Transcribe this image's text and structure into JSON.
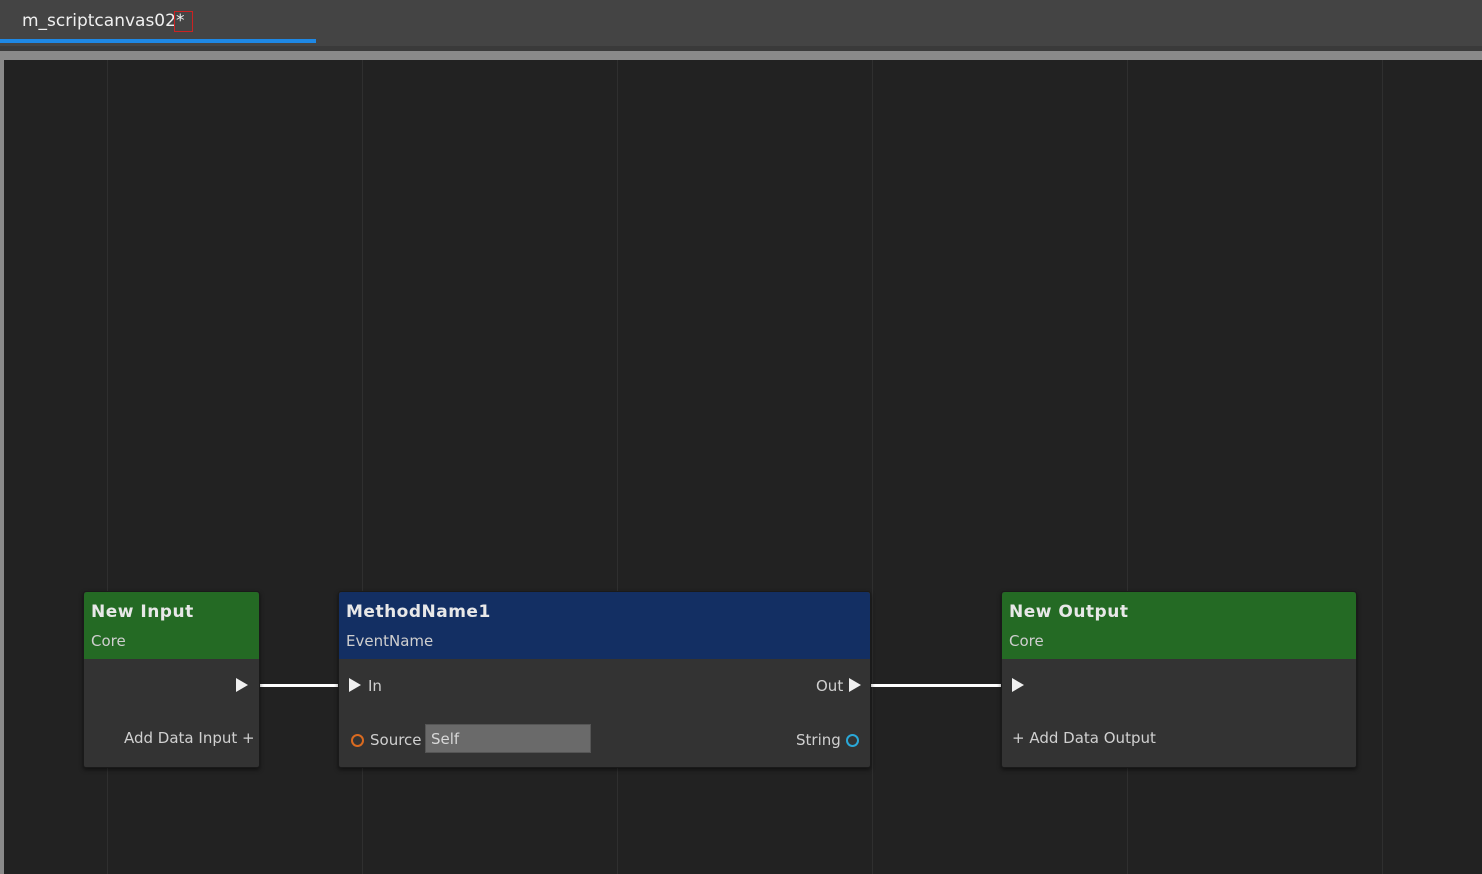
{
  "tab": {
    "title": "m_scriptcanvas02",
    "dirty_marker": "*"
  },
  "colors": {
    "input_output_header": "#246a24",
    "method_header": "#132f63",
    "tab_underline": "#1e88e5",
    "source_pin": "#d96a20",
    "string_pin": "#2aa8d8"
  },
  "nodes": {
    "new_input": {
      "title": "New Input",
      "subtitle": "Core",
      "add_label": "Add Data Input",
      "add_icon": "+"
    },
    "method": {
      "title": "MethodName1",
      "subtitle": "EventName",
      "in_label": "In",
      "out_label": "Out",
      "source_label": "Source",
      "source_value": "Self",
      "string_label": "String"
    },
    "new_output": {
      "title": "New Output",
      "subtitle": "Core",
      "add_label": "Add Data Output",
      "add_icon": "+"
    }
  }
}
